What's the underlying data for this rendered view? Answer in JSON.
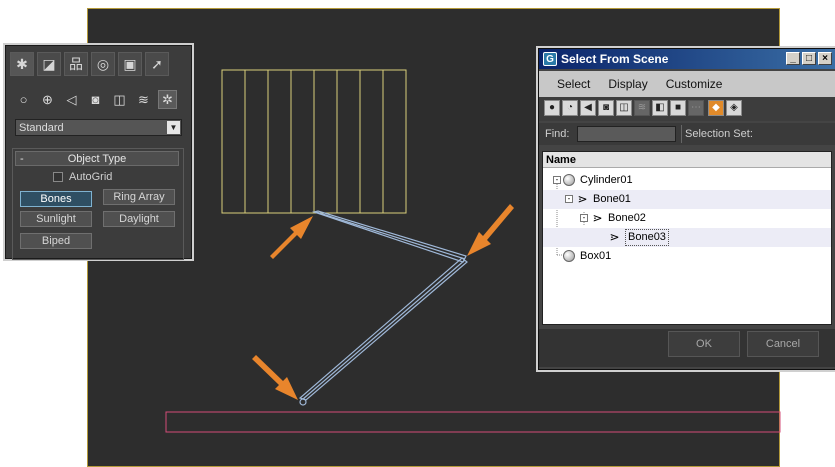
{
  "command_panel": {
    "tabs": [
      "create-icon",
      "modify-icon",
      "hierarchy-icon",
      "motion-icon",
      "display-icon",
      "utilities-icon"
    ],
    "category_icons": [
      "geometry-icon",
      "shapes-icon",
      "lights-icon",
      "cameras-icon",
      "helpers-icon",
      "spacewarps-icon",
      "systems-icon"
    ],
    "dropdown_value": "Standard",
    "rollout_title": "Object Type",
    "rollout_toggle": "-",
    "autogrid_label": "AutoGrid",
    "buttons": [
      "Bones",
      "Ring Array",
      "Sunlight",
      "Daylight",
      "Biped"
    ],
    "active_button": "Bones"
  },
  "dialog": {
    "title": "Select From Scene",
    "logo": "G",
    "window_buttons": [
      "_",
      "□",
      "×"
    ],
    "menu": [
      "Select",
      "Display",
      "Customize"
    ],
    "find_label": "Find:",
    "find_value": "",
    "selection_set_label": "Selection Set:",
    "column_header": "Name",
    "tree": [
      {
        "name": "Cylinder01",
        "type": "sphere-icon",
        "expander": "-"
      },
      {
        "name": "Bone01",
        "type": "bone-icon",
        "expander": "-"
      },
      {
        "name": "Bone02",
        "type": "bone-icon",
        "expander": "-"
      },
      {
        "name": "Bone03",
        "type": "bone-icon",
        "expander": ""
      },
      {
        "name": "Box01",
        "type": "sphere-icon",
        "expander": ""
      }
    ],
    "ok_label": "OK",
    "cancel_label": "Cancel"
  },
  "colors": {
    "viewport_bg": "#2d2d2d",
    "grid_object": "#d9cf7a",
    "bone": "#9fb8d8",
    "arrow": "#e8852c",
    "ground_box": "#d34c78"
  }
}
